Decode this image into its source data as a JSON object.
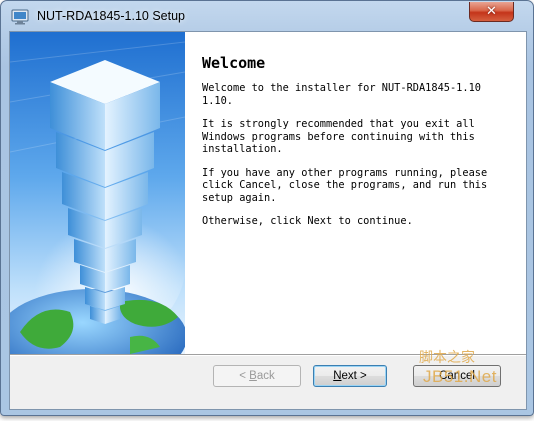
{
  "window": {
    "title": "NUT-RDA1845-1.10 Setup",
    "close_glyph": "✕"
  },
  "welcome": {
    "title": "Welcome",
    "paragraphs": [
      "Welcome to the installer for NUT-RDA1845-1.10\n1.10.",
      "It is strongly recommended that you exit all\nWindows programs before continuing with this\ninstallation.",
      "If you have any other programs running, please\nclick Cancel, close the programs, and run this\nsetup again.",
      "Otherwise, click Next to continue."
    ]
  },
  "buttons": {
    "back": {
      "arrow": "< ",
      "mnemonic": "B",
      "rest": "ack"
    },
    "next": {
      "mnemonic": "N",
      "rest": "ext",
      "arrow": " >"
    },
    "cancel": {
      "label": "Cancel"
    }
  },
  "watermark": {
    "chinese": "脚本之家",
    "site": "JB51.Net"
  },
  "colors": {
    "title_bar": "#b3cbe6",
    "close_button": "#c4341a",
    "dialog_bg": "#f0f0f0",
    "content_bg": "#ffffff",
    "watermark": "#e0a848",
    "next_focus": "#3c7fb1"
  },
  "icons": {
    "app": "installer-app-icon",
    "close": "close-icon",
    "banner": "cube-tower-globe-banner"
  }
}
